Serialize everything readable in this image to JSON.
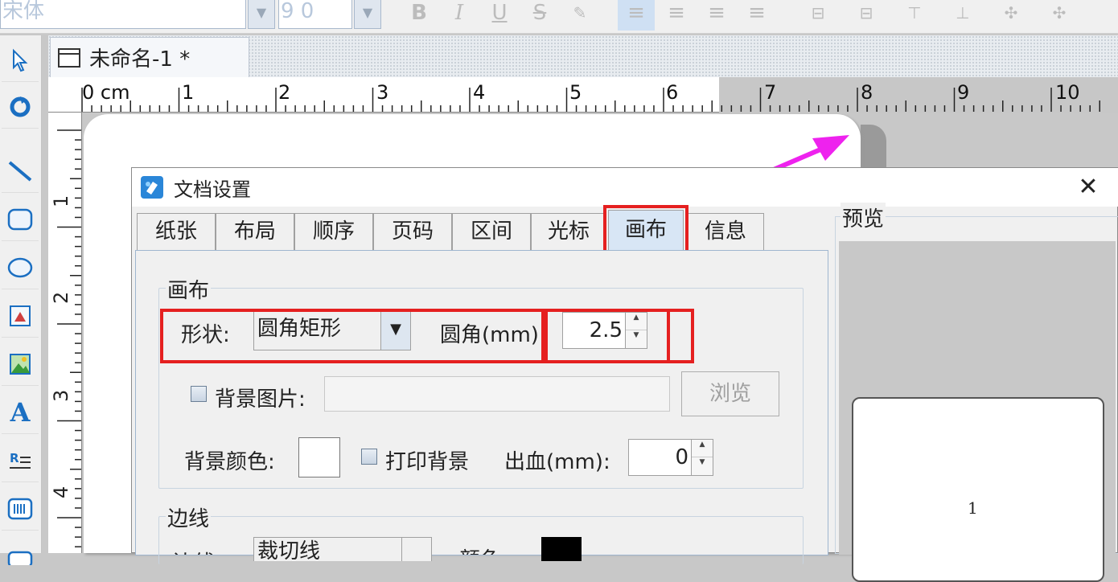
{
  "toolbar": {
    "font_name": "宋体",
    "font_size": "9 0"
  },
  "document": {
    "tab_title": "未命名-1 *"
  },
  "ruler": {
    "h_labels": [
      "0 cm",
      "1",
      "2",
      "3",
      "4",
      "5",
      "6",
      "7",
      "8",
      "9",
      "10"
    ],
    "v_labels": [
      "1",
      "2",
      "3",
      "4"
    ]
  },
  "dialog": {
    "title": "文档设置",
    "tabs": [
      "纸张",
      "布局",
      "顺序",
      "页码",
      "区间",
      "光标",
      "画布",
      "信息"
    ],
    "selected_tab": "画布",
    "canvas_group": {
      "label": "画布",
      "shape_label": "形状:",
      "shape_value": "圆角矩形",
      "radius_label": "圆角(mm):",
      "radius_value": "2.5",
      "bg_image_label": "背景图片:",
      "browse_label": "浏览",
      "bg_color_label": "背景颜色:",
      "print_bg_label": "打印背景",
      "bleed_label": "出血(mm):",
      "bleed_value": "0"
    },
    "border_group": {
      "label": "边线",
      "line_label": "边线:",
      "line_value": "裁切线",
      "color_label": "颜色:"
    },
    "preview": {
      "label": "预览",
      "page_number": "1"
    }
  },
  "colors": {
    "highlight": "#e52020",
    "arrow": "#ee22ee",
    "selected_tab": "#d8e6f5"
  }
}
